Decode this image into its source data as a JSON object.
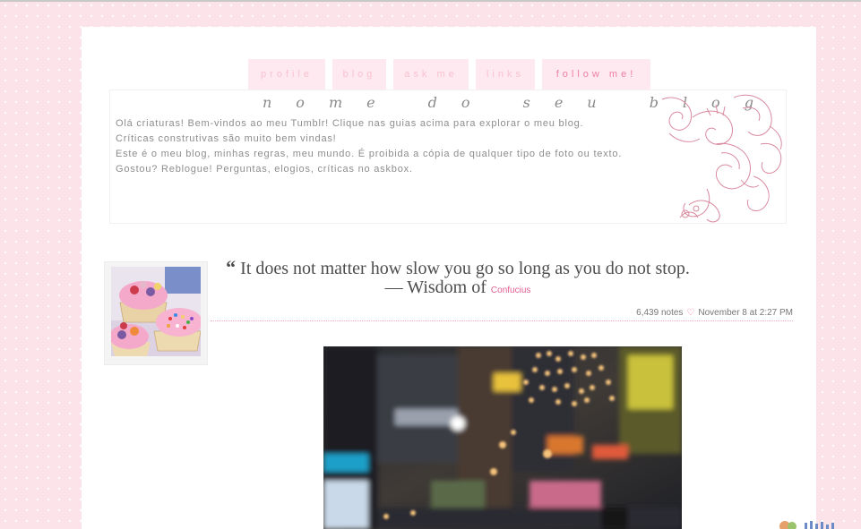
{
  "nav": {
    "tabs": [
      "profile",
      "blog",
      "ask me",
      "links",
      "follow me!"
    ]
  },
  "header": {
    "title": "nome do seu blog",
    "description": [
      "Olá criaturas! Bem-vindos ao meu Tumblr! Clique nas guias acima para explorar o meu blog.",
      "Críticas construtivas são muito bem vindas!",
      "Este é o meu blog, minhas regras, meu mundo. É proibida a cópia de qualquer tipo de foto ou texto.",
      "Gostou? Reblogue! Perguntas, elogios, críticas no askbox."
    ]
  },
  "post": {
    "quote_mark": "“",
    "quote_text": "It does not matter how slow you go so long as you do not stop.",
    "source_prefix": "— Wisdom of",
    "source_link": "Confucius",
    "notes": "6,439 notes",
    "date": "November 8 at 2:27 PM"
  },
  "colors": {
    "background": "#fce3ea",
    "tab_background": "#fde9ef",
    "tab_text": "#f9c2d1",
    "accent": "#f080a6",
    "link": "#e25e8f"
  },
  "icons": {
    "heart": "♡"
  }
}
